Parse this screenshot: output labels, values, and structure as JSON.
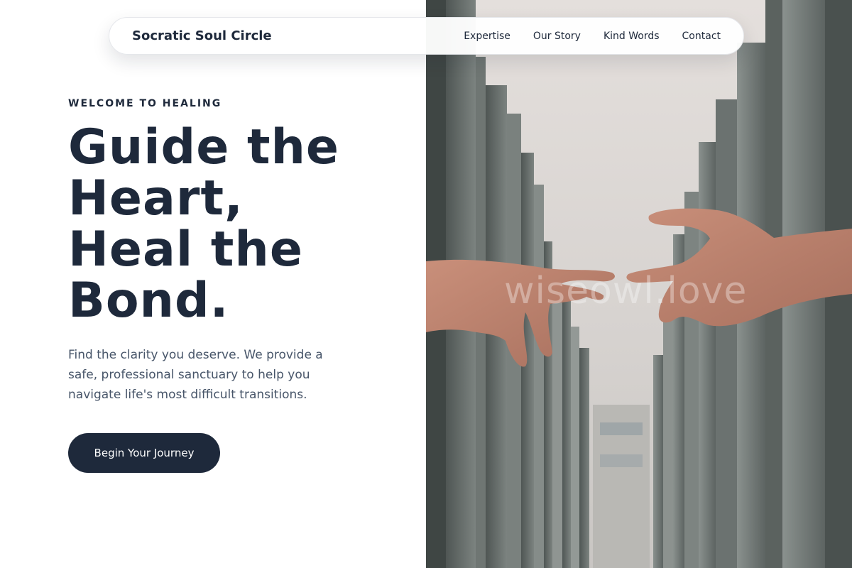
{
  "nav": {
    "brand": "Socratic Soul Circle",
    "links": [
      "Expertise",
      "Our Story",
      "Kind Words",
      "Contact"
    ]
  },
  "hero": {
    "eyebrow": "WELCOME TO HEALING",
    "title_lines": [
      "Guide the",
      "Heart,",
      "Heal the",
      "Bond."
    ],
    "description": "Find the clarity you deserve. We provide a safe, professional sanctuary to help you navigate life's most difficult transitions.",
    "cta_label": "Begin Your Journey"
  },
  "image": {
    "subject": "two-hands-reaching-icon",
    "watermark": "wiseowl.love"
  },
  "colors": {
    "primary": "#1e293b",
    "text_muted": "#475569",
    "background": "#ffffff"
  }
}
